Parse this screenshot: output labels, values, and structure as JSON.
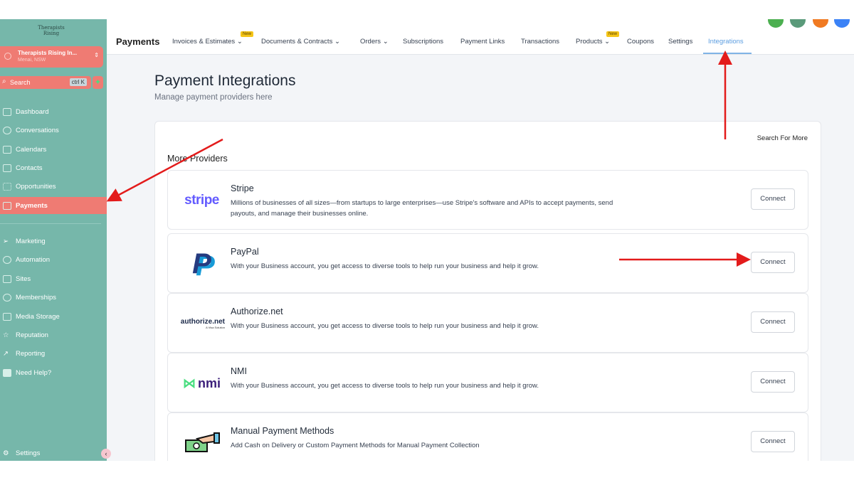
{
  "sidebar": {
    "logo": "Therapists Rising",
    "location_name": "Therapists Rising In...",
    "location_sub": "Menai, NSW",
    "search": "Search",
    "shortcut": "ctrl K",
    "items": [
      {
        "label": "Dashboard"
      },
      {
        "label": "Conversations"
      },
      {
        "label": "Calendars"
      },
      {
        "label": "Contacts"
      },
      {
        "label": "Opportunities"
      },
      {
        "label": "Payments"
      },
      {
        "label": "Marketing"
      },
      {
        "label": "Automation"
      },
      {
        "label": "Sites"
      },
      {
        "label": "Memberships"
      },
      {
        "label": "Media Storage"
      },
      {
        "label": "Reputation"
      },
      {
        "label": "Reporting"
      },
      {
        "label": "Need Help?"
      }
    ],
    "settings": "Settings"
  },
  "topbar": {
    "title": "Payments",
    "badge": "New",
    "tabs": [
      {
        "label": "Invoices & Estimates"
      },
      {
        "label": "Documents & Contracts"
      },
      {
        "label": "Orders"
      },
      {
        "label": "Subscriptions"
      },
      {
        "label": "Payment Links"
      },
      {
        "label": "Transactions"
      },
      {
        "label": "Products"
      },
      {
        "label": "Coupons"
      },
      {
        "label": "Settings"
      },
      {
        "label": "Integrations"
      }
    ],
    "active_tab": "Integrations"
  },
  "page": {
    "title": "Payment Integrations",
    "subtitle": "Manage payment providers here",
    "search_more": "Search For More",
    "section": "More Providers"
  },
  "providers": [
    {
      "name": "Stripe",
      "logo": "stripe",
      "desc": "Millions of businesses of all sizes—from startups to large enterprises—use Stripe's software and APIs to accept payments, send payouts, and manage their businesses online.",
      "button": "Connect"
    },
    {
      "name": "PayPal",
      "logo": "P",
      "desc": "With your Business account, you get access to diverse tools to help run your business and help it grow.",
      "button": "Connect"
    },
    {
      "name": "Authorize.net",
      "logo": "authorize.net",
      "logo_sub": "A Visa Solution",
      "desc": "With your Business account, you get access to diverse tools to help run your business and help it grow.",
      "button": "Connect"
    },
    {
      "name": "NMI",
      "logo": "nmi",
      "desc": "With your Business account, you get access to diverse tools to help run your business and help it grow.",
      "button": "Connect"
    },
    {
      "name": "Manual Payment Methods",
      "desc": "Add Cash on Delivery or Custom Payment Methods for Manual Payment Collection",
      "button": "Connect"
    }
  ],
  "colors": {
    "sidebar": "#76b7aa",
    "active": "#ef7b73",
    "accent": "#5b9de0",
    "arrow": "#e31b1b"
  }
}
